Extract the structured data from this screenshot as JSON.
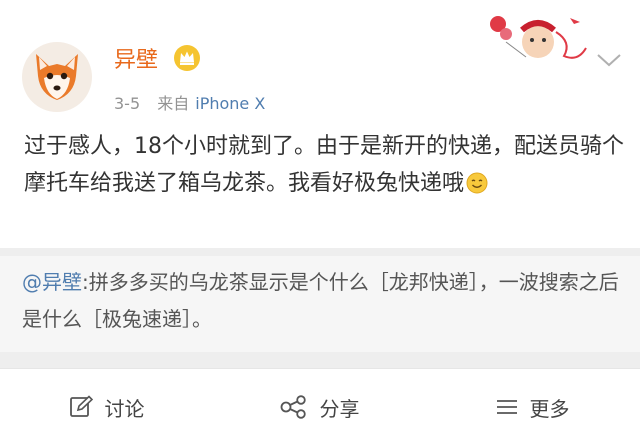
{
  "post": {
    "username": "异壁",
    "timestamp": "3-5",
    "source_prefix": "来自",
    "source": "iPhone X",
    "text": "过于感人，18个小时就到了。由于是新开的快递，配送员骑个摩托车给我送了箱乌龙茶。我看好极兔快递哦"
  },
  "repost": {
    "mention": "@异壁",
    "text": ":拼多多买的乌龙茶显示是个什么［龙邦快递］，一波搜索之后是什么［极兔速递］。"
  },
  "actions": {
    "comment": "讨论",
    "share": "分享",
    "more": "更多"
  },
  "icons": {
    "avatar": "fox-avatar",
    "vip": "crown-badge-icon",
    "dropdown": "chevron-down-icon",
    "emoji": "smile-emoji-icon",
    "comment": "edit-icon",
    "share": "share-icon",
    "more": "list-icon"
  },
  "colors": {
    "username": "#e8691c",
    "link": "#507daf",
    "text": "#333333",
    "meta": "#939393"
  }
}
